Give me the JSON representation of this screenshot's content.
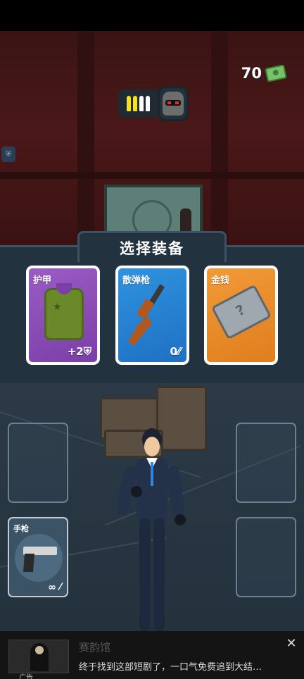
{
  "hud": {
    "cash_value": "70",
    "cash_icon": "cash-stack-icon",
    "ammo_icons": [
      "bullet-icon",
      "bullet-icon",
      "bullet-icon",
      "bullet-icon"
    ],
    "boss_icon": "masked-boss-icon"
  },
  "panel": {
    "title": "选择装备",
    "cards": [
      {
        "label": "护甲",
        "stat": "+2",
        "stat_icon": "shield-icon",
        "icon": "armor-vest-icon",
        "color": "#8a4dba"
      },
      {
        "label": "散弹枪",
        "stat": "0",
        "stat_icon": "ammo-icon",
        "icon": "shotgun-icon",
        "color": "#2a85d6"
      },
      {
        "label": "金钱",
        "stat": "",
        "stat_icon": "",
        "icon": "money-case-icon",
        "color": "#ee8d2b"
      }
    ]
  },
  "loadout": {
    "slots": [
      {
        "label": "",
        "stat": ""
      },
      {
        "label": "",
        "stat": ""
      },
      {
        "label": "手枪",
        "stat": "∞",
        "stat_icon": "ammo-icon",
        "icon": "pistol-icon"
      },
      {
        "label": "",
        "stat": ""
      }
    ]
  },
  "ad": {
    "title": "赛韵馆",
    "tag": "广告",
    "text": "终于找到这部短剧了，一口气免费追到大结…",
    "close_icon": "close-icon"
  }
}
